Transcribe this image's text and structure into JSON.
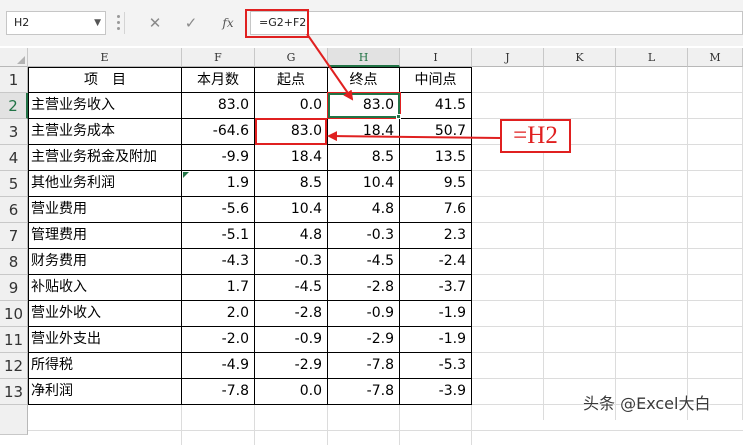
{
  "name_box": {
    "value": "H2"
  },
  "formula_bar": {
    "fx_label": "fx",
    "formula": "=G2+F2"
  },
  "columns": [
    "E",
    "F",
    "G",
    "H",
    "I",
    "J",
    "K",
    "L",
    "M"
  ],
  "selected_column": "H",
  "rows": [
    "1",
    "2",
    "3",
    "4",
    "5",
    "6",
    "7",
    "8",
    "9",
    "10",
    "11",
    "12",
    "13"
  ],
  "selected_row": "2",
  "table": {
    "headers": [
      "项　目",
      "本月数",
      "起点",
      "终点",
      "中间点"
    ],
    "rows": [
      [
        "主营业务收入",
        "83.0",
        "0.0",
        "83.0",
        "41.5"
      ],
      [
        "主营业务成本",
        "-64.6",
        "83.0",
        "18.4",
        "50.7"
      ],
      [
        "主营业务税金及附加",
        "-9.9",
        "18.4",
        "8.5",
        "13.5"
      ],
      [
        "其他业务利润",
        "1.9",
        "8.5",
        "10.4",
        "9.5"
      ],
      [
        "营业费用",
        "-5.6",
        "10.4",
        "4.8",
        "7.6"
      ],
      [
        "管理费用",
        "-5.1",
        "4.8",
        "-0.3",
        "2.3"
      ],
      [
        "财务费用",
        "-4.3",
        "-0.3",
        "-4.5",
        "-2.4"
      ],
      [
        "补贴收入",
        "1.7",
        "-4.5",
        "-2.8",
        "-3.7"
      ],
      [
        "营业外收入",
        "2.0",
        "-2.8",
        "-0.9",
        "-1.9"
      ],
      [
        "营业外支出",
        "-2.0",
        "-0.9",
        "-2.9",
        "-1.9"
      ],
      [
        "所得税",
        "-4.9",
        "-2.9",
        "-7.8",
        "-5.3"
      ],
      [
        "净利润",
        "-7.8",
        "0.0",
        "-7.8",
        "-3.9"
      ]
    ]
  },
  "annotation": {
    "label": "=H2",
    "color": "#e02020"
  },
  "watermark": "头条 @Excel大白",
  "colors": {
    "accent_green": "#217346",
    "annotation_red": "#e02020"
  }
}
